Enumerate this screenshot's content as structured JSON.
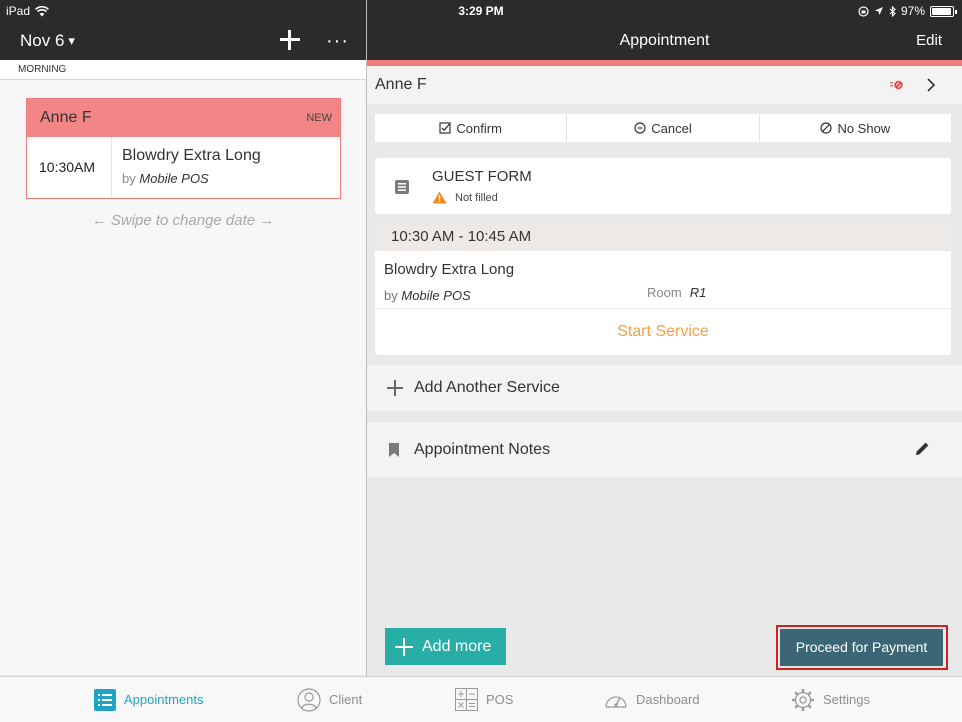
{
  "status_bar": {
    "device": "iPad",
    "time": "3:29 PM",
    "battery": "97%"
  },
  "left_header": {
    "date": "Nov 6",
    "dropdown_arrow": "▾",
    "more": "···"
  },
  "right_header": {
    "title": "Appointment",
    "edit_label": "Edit"
  },
  "left_panel": {
    "period": "MORNING",
    "appointment": {
      "client": "Anne F",
      "badge": "NEW",
      "time": "10:30AM",
      "service": "Blowdry Extra Long",
      "by_prefix": "by",
      "by_name": "Mobile POS"
    },
    "swipe_hint": "← Swipe to change date →"
  },
  "detail": {
    "client_name": "Anne F",
    "actions": {
      "confirm": "Confirm",
      "cancel": "Cancel",
      "no_show": "No Show"
    },
    "guest_form": {
      "title": "GUEST FORM",
      "status": "Not filled"
    },
    "service": {
      "time_range": "10:30 AM - 10:45 AM",
      "name": "Blowdry Extra Long",
      "by_prefix": "by",
      "by_name": "Mobile POS",
      "room_label": "Room",
      "room_value": "R1",
      "start_label": "Start Service"
    },
    "add_service_label": "Add Another Service",
    "notes_label": "Appointment Notes",
    "add_more_label": "Add more",
    "proceed_label": "Proceed for Payment"
  },
  "tabs": [
    {
      "label": "Appointments",
      "icon": "list-icon",
      "active": true
    },
    {
      "label": "Client",
      "icon": "person-icon",
      "active": false
    },
    {
      "label": "POS",
      "icon": "calculator-icon",
      "active": false
    },
    {
      "label": "Dashboard",
      "icon": "gauge-icon",
      "active": false
    },
    {
      "label": "Settings",
      "icon": "gear-icon",
      "active": false
    }
  ],
  "colors": {
    "header_bg": "#2b2b2b",
    "accent_red": "#ef7b7b",
    "teal": "#28aea7",
    "proceed_bg": "#3c6676",
    "start_service": "#f5a043",
    "active_tab": "#20a4c3"
  }
}
